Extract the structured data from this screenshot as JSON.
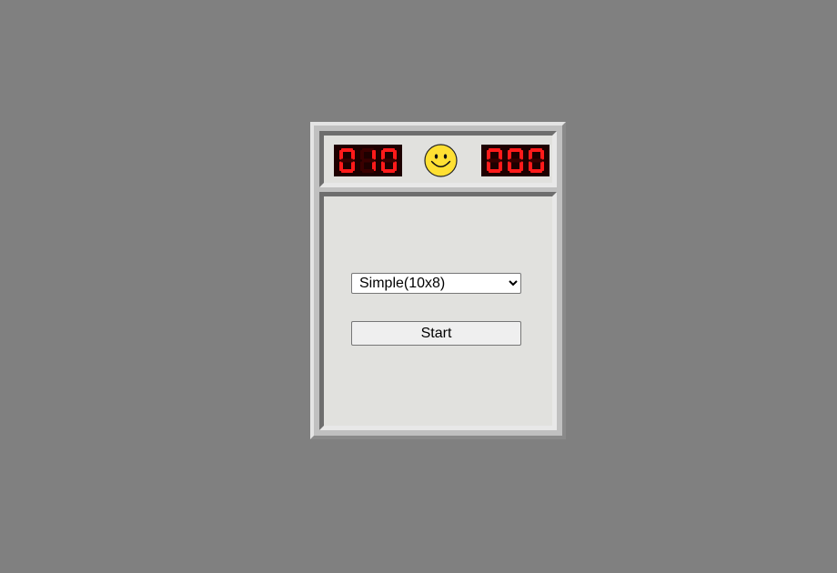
{
  "header": {
    "mine_counter": "010",
    "timer": "000",
    "face": "smiley-face-icon"
  },
  "controls": {
    "difficulty_selected": "Simple(10x8)",
    "difficulty_options": [
      "Simple(10x8)"
    ],
    "start_label": "Start"
  },
  "colors": {
    "background": "#808080",
    "panel": "#e1e1de",
    "frame": "#c0c0c0",
    "led_on": "#ff1a1a",
    "led_off": "#3a0000",
    "led_bg": "#1e0000",
    "face_yellow": "#ffe033"
  }
}
